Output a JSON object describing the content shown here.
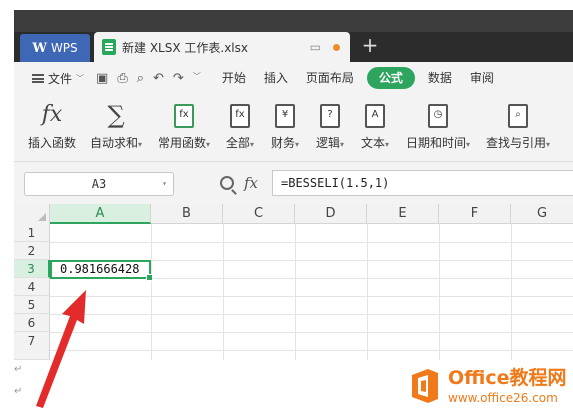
{
  "tabs": {
    "wps_label": "WPS",
    "document_name": "新建 XLSX 工作表.xlsx",
    "new_tab": "+"
  },
  "menu": {
    "file_label": "文件",
    "items": [
      "开始",
      "插入",
      "页面布局",
      "公式",
      "数据",
      "审阅"
    ],
    "active": "公式"
  },
  "ribbon": {
    "buttons": [
      {
        "label": "插入函数",
        "icon": "fx-icon",
        "glyph": "fx"
      },
      {
        "label": "自动求和",
        "icon": "sigma-icon",
        "glyph": "∑"
      },
      {
        "label": "常用函数",
        "icon": "common-functions-icon",
        "glyph": "fx"
      },
      {
        "label": "全部",
        "icon": "all-functions-icon",
        "glyph": "fx"
      },
      {
        "label": "财务",
        "icon": "finance-icon",
        "glyph": "¥"
      },
      {
        "label": "逻辑",
        "icon": "logic-icon",
        "glyph": "?"
      },
      {
        "label": "文本",
        "icon": "text-icon",
        "glyph": "A"
      },
      {
        "label": "日期和时间",
        "icon": "datetime-icon",
        "glyph": "◷"
      },
      {
        "label": "查找与引用",
        "icon": "lookup-icon",
        "glyph": "🔍"
      }
    ]
  },
  "formula_bar": {
    "name_box": "A3",
    "fx": "fx",
    "formula": "=BESSELI(1.5,1)"
  },
  "grid": {
    "columns": [
      "A",
      "B",
      "C",
      "D",
      "E",
      "F",
      "G"
    ],
    "rows": [
      "1",
      "2",
      "3",
      "4",
      "5",
      "6",
      "7"
    ],
    "selected_column": "A",
    "selected_row": "3",
    "cell_a3_value": "0.981666428"
  },
  "brand": {
    "title": "Office教程网",
    "url": "www.office26.com"
  },
  "colors": {
    "accent_green": "#2ea55e",
    "wps_blue": "#3e67b6",
    "brand_orange": "#f07a1a"
  }
}
